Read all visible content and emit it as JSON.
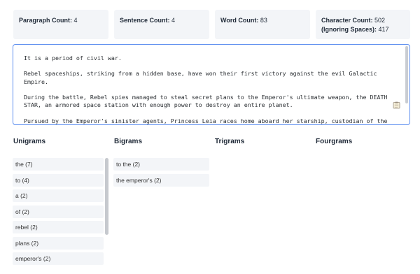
{
  "stats": {
    "paragraph_label": "Paragraph Count:",
    "paragraph_value": "4",
    "sentence_label": "Sentence Count:",
    "sentence_value": "4",
    "word_label": "Word Count:",
    "word_value": "83",
    "character_label": "Character Count:",
    "character_value": "502",
    "ignoring_label": "(Ignoring Spaces):",
    "ignoring_value": "417"
  },
  "editor": {
    "paragraphs": [
      "It is a period of civil war.",
      "Rebel spaceships, striking from a hidden base, have won their first victory against the evil Galactic Empire.",
      "During the battle, Rebel spies managed to steal secret plans to the Emperor's ultimate weapon, the DEATH STAR, an armored space station with enough power to destroy an entire planet.",
      "Pursued by the Emperor's sinister agents, Princess Leia races home aboard her starship, custodian of the stolen plans that can save her people and restore freedom to the galaxy."
    ],
    "copy_icon": "clipboard-icon"
  },
  "columns": {
    "unigrams": "Unigrams",
    "bigrams": "Bigrams",
    "trigrams": "Trigrams",
    "fourgrams": "Fourgrams"
  },
  "unigrams": [
    "the (7)",
    "to (4)",
    "a (2)",
    "of (2)",
    "rebel (2)",
    "plans (2)",
    "emperor's (2)"
  ],
  "bigrams": [
    "to the (2)",
    "the emperor's (2)"
  ]
}
